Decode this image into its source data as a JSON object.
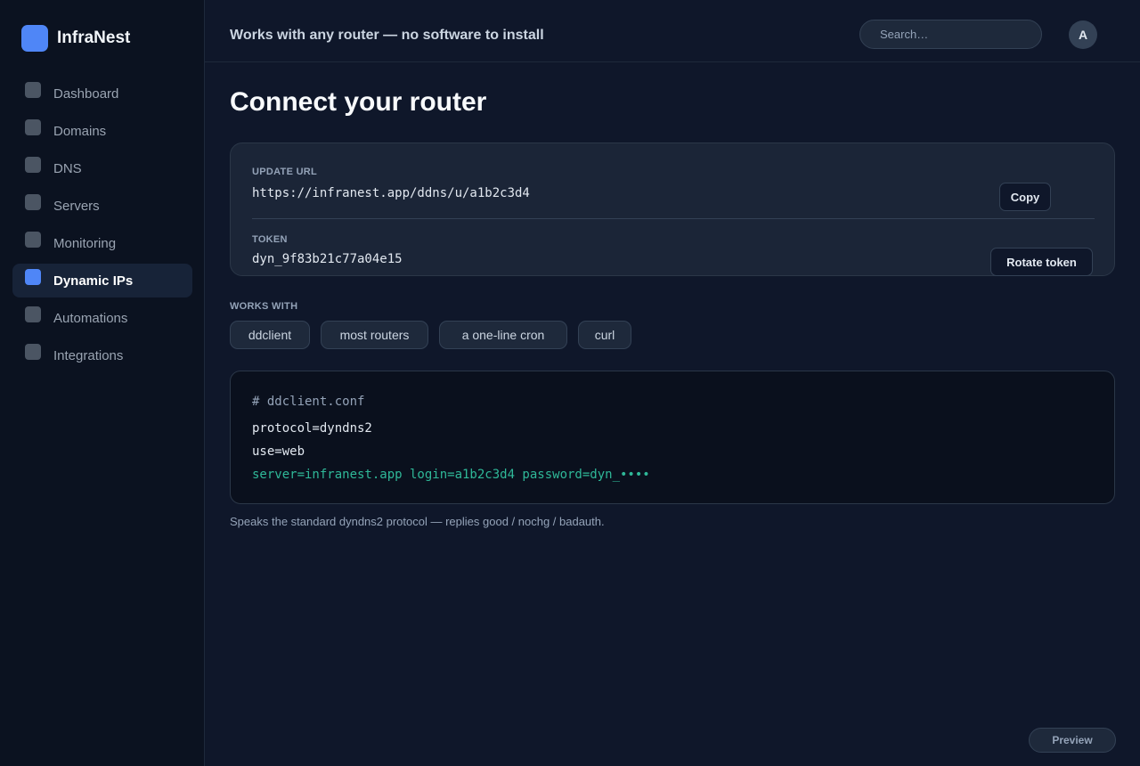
{
  "brand": {
    "name": "InfraNest"
  },
  "sidebar": {
    "items": [
      {
        "label": "Dashboard",
        "active": false
      },
      {
        "label": "Domains",
        "active": false
      },
      {
        "label": "DNS",
        "active": false
      },
      {
        "label": "Servers",
        "active": false
      },
      {
        "label": "Monitoring",
        "active": false
      },
      {
        "label": "Dynamic IPs",
        "active": true
      },
      {
        "label": "Automations",
        "active": false
      },
      {
        "label": "Integrations",
        "active": false
      }
    ]
  },
  "topbar": {
    "title": "Works with any router — no software to install",
    "search_placeholder": "Search…",
    "avatar_initial": "A"
  },
  "page": {
    "title": "Connect your router"
  },
  "connection": {
    "update_url_label": "UPDATE URL",
    "update_url": "https://infranest.app/ddns/u/a1b2c3d4",
    "copy_label": "Copy",
    "token_label": "TOKEN",
    "token": "dyn_9f83b21c77a04e15",
    "rotate_label": "Rotate token"
  },
  "works_with": {
    "label": "WORKS WITH",
    "chips": [
      "ddclient",
      "most routers",
      "a one-line cron",
      "curl"
    ]
  },
  "code": {
    "comment": "# ddclient.conf",
    "line1": "protocol=dyndns2",
    "line2": "use=web",
    "line3": "server=infranest.app login=a1b2c3d4 password=dyn_••••"
  },
  "note": "Speaks the standard dyndns2 protocol — replies good / nochg / badauth.",
  "preview_label": "Preview",
  "colors": {
    "accent": "#4f86f7",
    "code_accent": "#2fb898",
    "background": "#0f172a",
    "sidebar_bg": "#0b1220"
  }
}
